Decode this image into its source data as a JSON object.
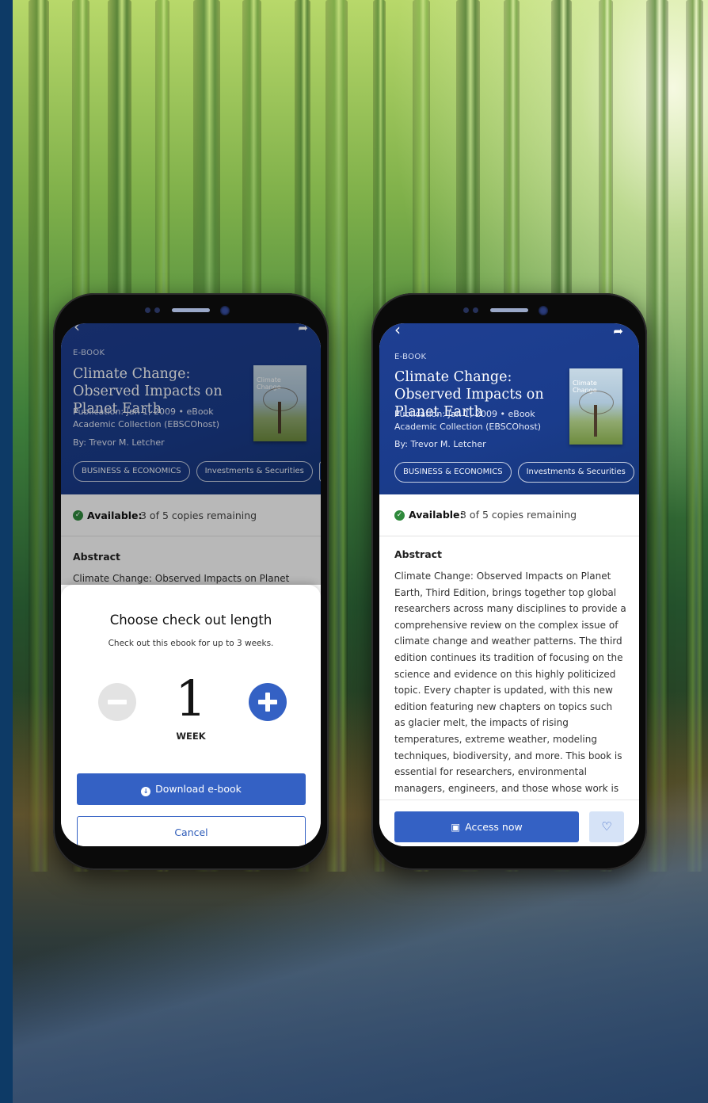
{
  "colors": {
    "header_bg": "#1a3c8c",
    "primary": "#3461c4",
    "available": "#2f8a3c",
    "stepper_disabled": "#e3e3e3",
    "outer_frame": "#0d3a66"
  },
  "icons": {
    "back": "chevron-left",
    "share": "share-arrow",
    "available": "check-circle",
    "download": "download-circle",
    "access": "access-book",
    "favorite": "heart-outline",
    "minus": "minus-circle",
    "plus": "plus-circle"
  },
  "book": {
    "type": "E-BOOK",
    "title": "Climate Change: Observed Impacts on Planet Earth",
    "publication_label": "Publication:",
    "publication_value": "Jan 1, 2009 • eBook",
    "collection": "Academic Collection (EBSCOhost)",
    "author": "By: Trevor M. Letcher",
    "cover_text": "Climate Change",
    "subjects": [
      "BUSINESS & ECONOMICS",
      "Investments & Securities"
    ]
  },
  "availability": {
    "label": "Available:",
    "value": "3 of 5 copies remaining"
  },
  "abstract": {
    "heading": "Abstract",
    "left_preview": "Climate Change: Observed Impacts on Planet",
    "lines": [
      "Climate Change: Observed Impacts on Planet",
      "Earth, Third Edition, brings together top global",
      "researchers across many disciplines to provide a",
      "comprehensive review on the complex issue of",
      "climate change and weather patterns. The third",
      "edition continues its tradition of focusing on the",
      "science and evidence on this highly politicized",
      "topic. Every chapter is updated, with this new",
      "edition featuring new chapters on topics such",
      "as glacier melt, the impacts of rising",
      "temperatures, extreme weather, modeling",
      "techniques, biodiversity, and more. This book is",
      "essential for researchers, environmental",
      "managers, engineers, and those whose work is"
    ]
  },
  "checkout_sheet": {
    "title": "Choose check out length",
    "subtitle": "Check out this ebook for up to 3 weeks.",
    "quantity": "1",
    "unit": "WEEK",
    "download_label": "Download e-book",
    "cancel_label": "Cancel"
  },
  "detail_footer": {
    "access_label": "Access now"
  }
}
